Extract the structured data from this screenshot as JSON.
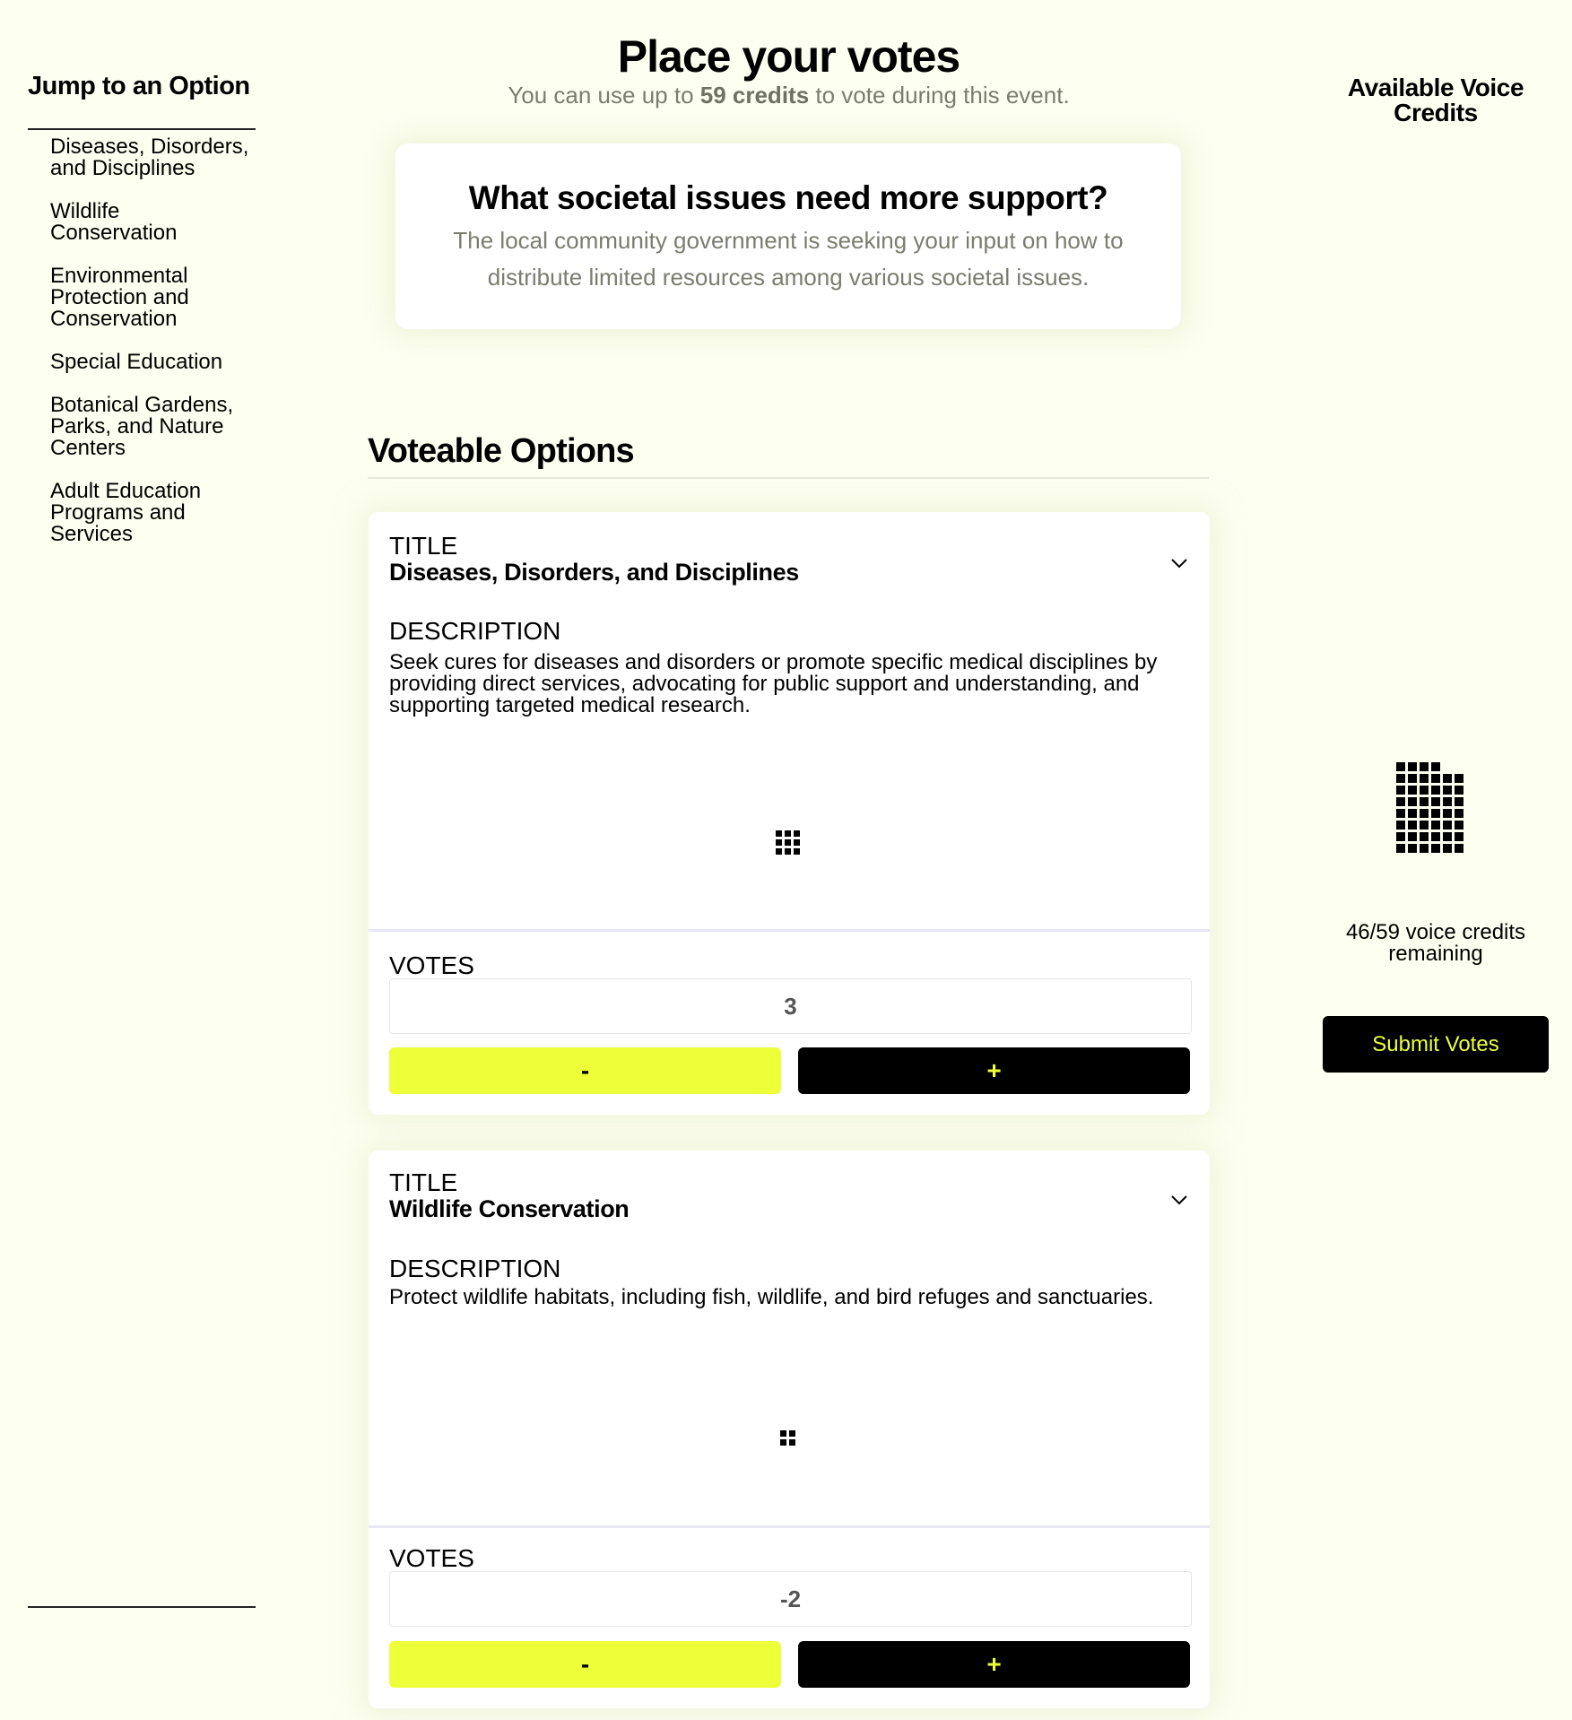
{
  "sidebar": {
    "title": "Jump to an Option",
    "items": [
      {
        "label": "Diseases, Disorders, and Disciplines"
      },
      {
        "label": "Wildlife Conservation"
      },
      {
        "label": "Environmental Protection and Conservation"
      },
      {
        "label": "Special Education"
      },
      {
        "label": "Botanical Gardens, Parks, and Nature Centers"
      },
      {
        "label": "Adult Education Programs and Services"
      }
    ]
  },
  "header": {
    "title": "Place your votes",
    "subtitle_before": "You can use up to ",
    "subtitle_credits": "59 credits",
    "subtitle_after": " to vote during this event."
  },
  "question": {
    "title": "What societal issues need more support?",
    "description": "The local community government is seeking your input on how to distribute limited resources among various societal issues."
  },
  "options_section": {
    "heading": "Voteable Options",
    "title_label": "TITLE",
    "description_label": "DESCRIPTION",
    "votes_label": "VOTES",
    "minus_label": "-",
    "plus_label": "+"
  },
  "options": [
    {
      "title": "Diseases, Disorders, and Disciplines",
      "description": "Seek cures for diseases and disorders or promote specific medical disciplines by providing direct services, advocating for public support and understanding, and supporting targeted medical research.",
      "votes": "3",
      "credits_used": 9
    },
    {
      "title": "Wildlife Conservation",
      "description": "Protect wildlife habitats, including fish, wildlife, and bird refuges and sanctuaries.",
      "votes": "-2",
      "credits_used": 4
    }
  ],
  "credits_panel": {
    "title": "Available Voice Credits",
    "remaining": 46,
    "total": 59,
    "remaining_text": "46/59 voice credits remaining",
    "submit_label": "Submit Votes"
  },
  "colors": {
    "background": "#fdfff0",
    "accent": "#edff38",
    "muted_text": "#7a7d6e"
  },
  "icons": {
    "collapse": "chevron-down-icon"
  }
}
